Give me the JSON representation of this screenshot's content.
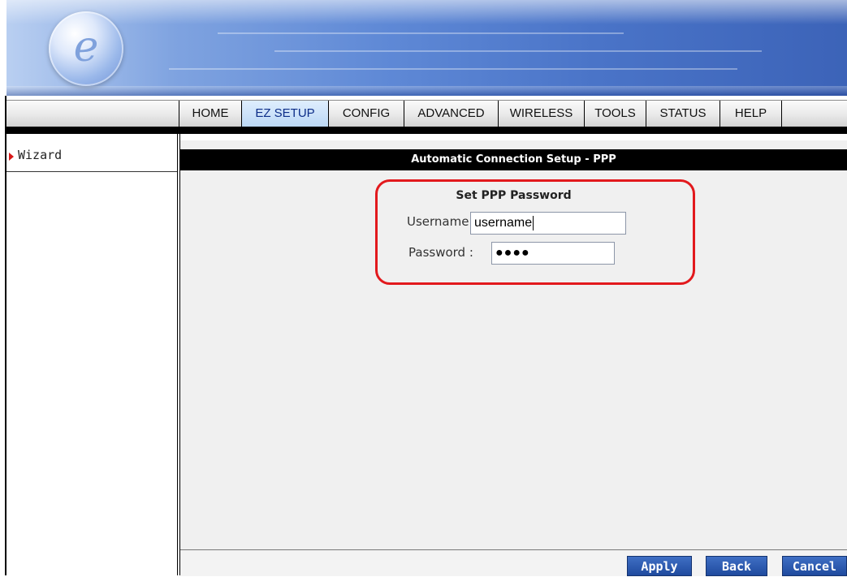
{
  "banner": {
    "logo_letter": "e"
  },
  "nav": {
    "tabs": [
      {
        "label": "HOME"
      },
      {
        "label": "EZ SETUP"
      },
      {
        "label": "CONFIG"
      },
      {
        "label": "ADVANCED"
      },
      {
        "label": "WIRELESS"
      },
      {
        "label": "TOOLS"
      },
      {
        "label": "STATUS"
      },
      {
        "label": "HELP"
      }
    ],
    "active_tab": "EZ SETUP"
  },
  "sidebar": {
    "items": [
      {
        "label": "Wizard"
      }
    ]
  },
  "main": {
    "title": "Automatic Connection Setup - PPP",
    "section_title": "Set PPP Password",
    "username": {
      "label": "Username :",
      "value": "username"
    },
    "password": {
      "label": "Password :",
      "masked_value": "●●●●"
    }
  },
  "footer": {
    "apply_label": "Apply",
    "back_label": "Back",
    "cancel_label": "Cancel"
  },
  "colors": {
    "highlight": "#e2191d",
    "button": "#2b5bb5",
    "title_bar": "#000000"
  }
}
